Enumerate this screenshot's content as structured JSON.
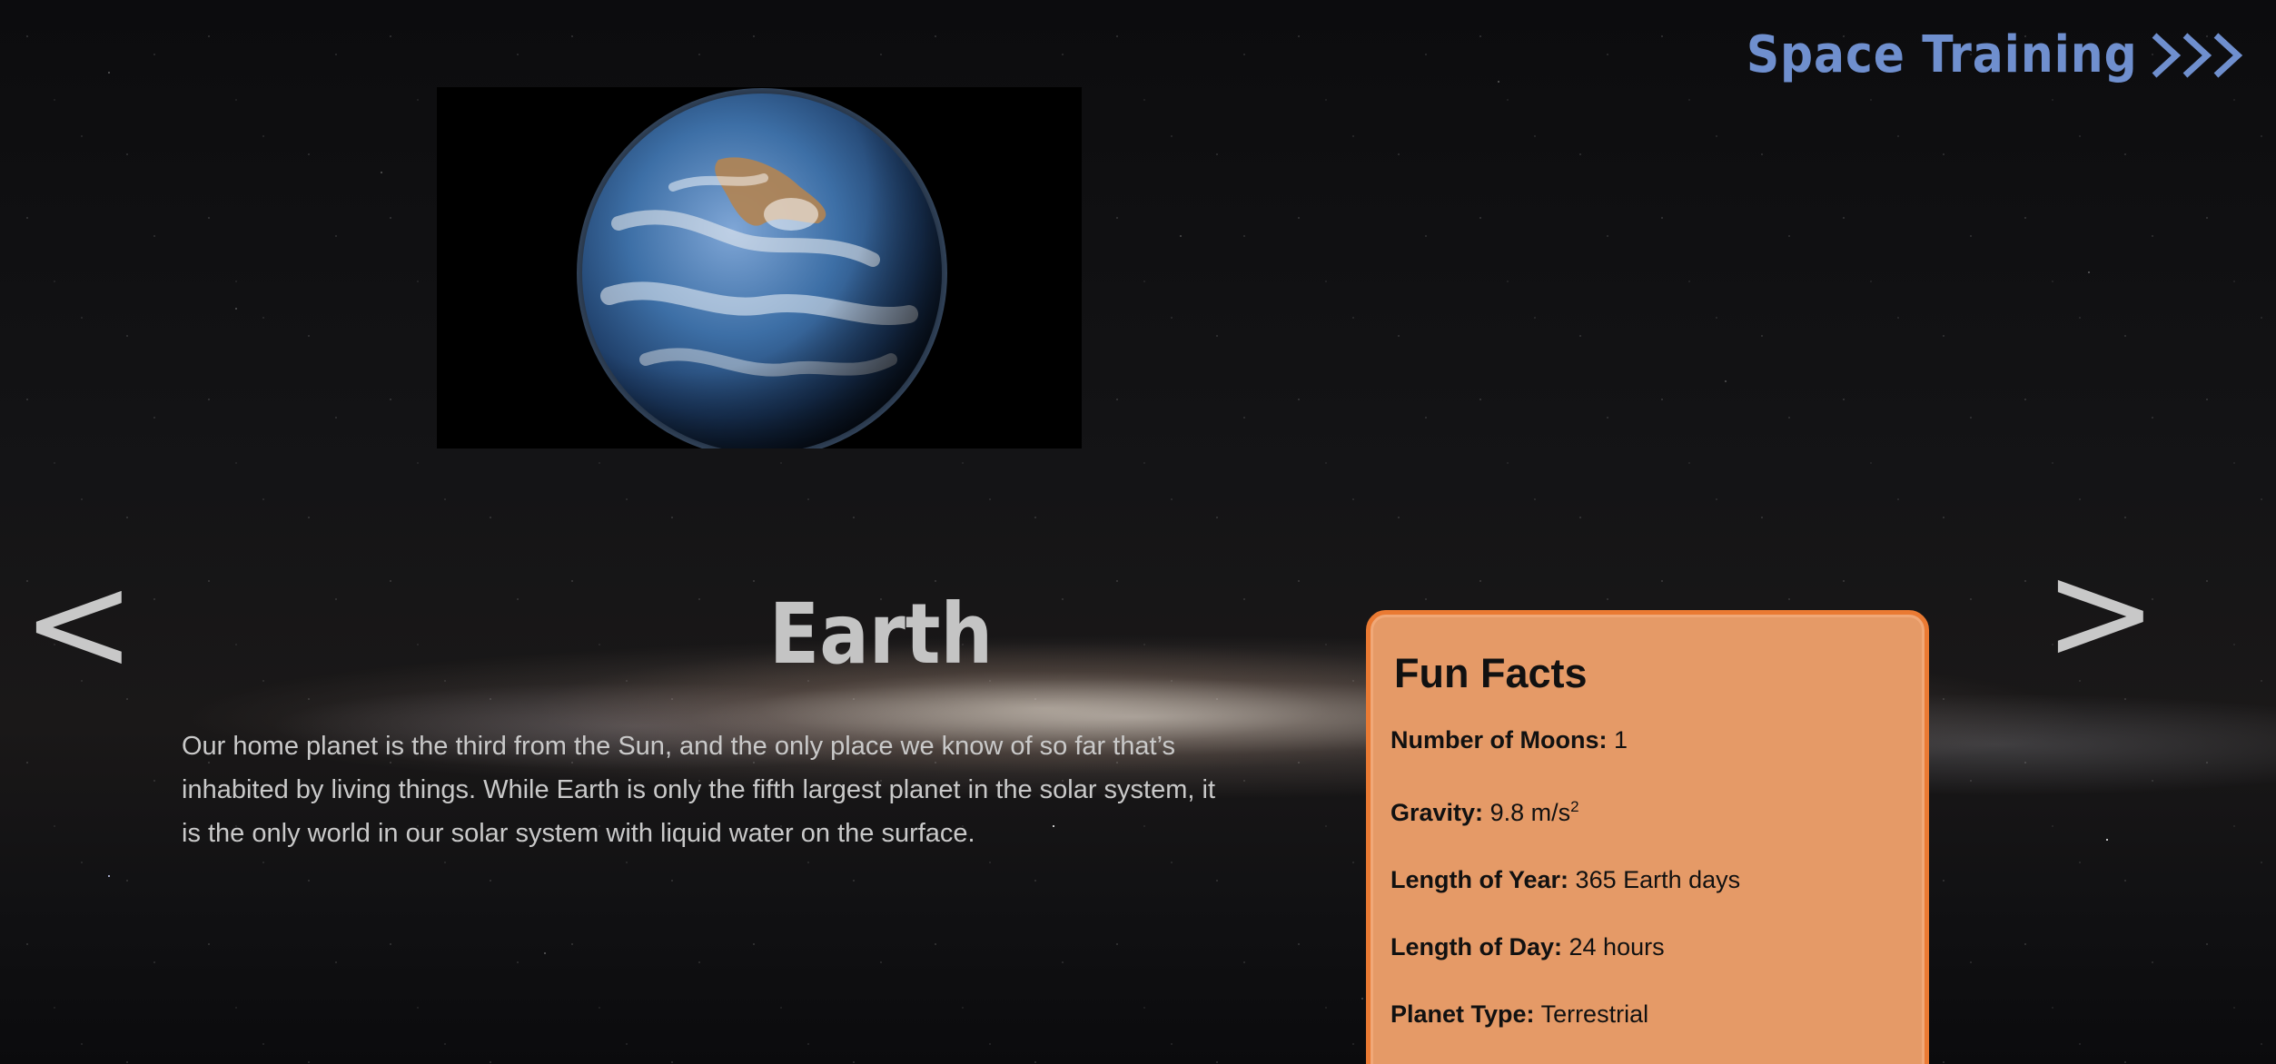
{
  "header": {
    "brand_label": "Space Training",
    "brand_icon": "triple-chevron-right-icon",
    "brand_color": "#6f8fce"
  },
  "navigation": {
    "prev_label": "<",
    "next_label": ">"
  },
  "planet": {
    "name": "Earth",
    "image_icon": "earth-globe-image",
    "description": "Our home planet is the third from the Sun, and the only place we know of so far that’s inhabited by living things. While Earth is only the fifth largest planet in the solar system, it is the only world in our solar system with liquid water on the surface."
  },
  "fun_facts": {
    "title": "Fun Facts",
    "card_color": "#e59a67",
    "border_color": "#ea7a33",
    "items": [
      {
        "label": "Number of Moons:",
        "value": "1"
      },
      {
        "label": "Gravity:",
        "value": "9.8 m/s",
        "value_superscript": "2"
      },
      {
        "label": "Length of Year:",
        "value": "365 Earth days"
      },
      {
        "label": "Length of Day:",
        "value": "24 hours"
      },
      {
        "label": "Planet Type:",
        "value": "Terrestrial"
      }
    ]
  }
}
